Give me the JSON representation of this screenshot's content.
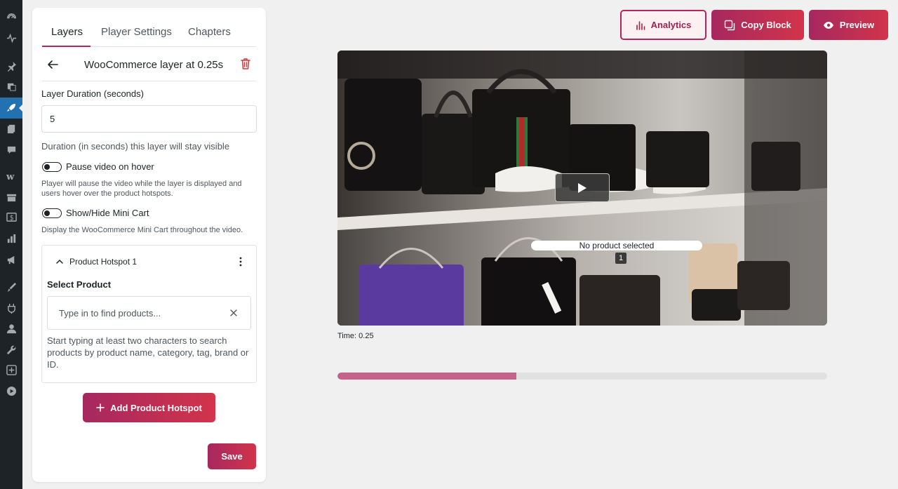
{
  "wp_sidebar": {
    "icons": [
      "dashboard-icon",
      "activity-icon",
      "pin-icon",
      "media-icon",
      "rocket-icon",
      "pages-icon",
      "comments-icon",
      "woocommerce-icon",
      "products-icon",
      "payments-icon",
      "analytics-icon",
      "marketing-icon",
      "appearance-icon",
      "plugins-icon",
      "users-icon",
      "tools-icon",
      "settings-icon",
      "video-player-icon"
    ],
    "active_index": 4
  },
  "panel": {
    "tabs": [
      {
        "label": "Layers",
        "active": true
      },
      {
        "label": "Player Settings",
        "active": false
      },
      {
        "label": "Chapters",
        "active": false
      }
    ],
    "layer_title": "WooCommerce layer at 0.25s",
    "duration": {
      "label": "Layer Duration (seconds)",
      "value": "5",
      "help": "Duration (in seconds) this layer will stay visible"
    },
    "pause_on_hover": {
      "label": "Pause video on hover",
      "help_line1": "Player will pause the video while the layer is displayed and",
      "help_line2": "users hover over the product hotspots.",
      "enabled": false
    },
    "mini_cart": {
      "label": "Show/Hide Mini Cart",
      "help": "Display the WooCommerce Mini Cart throughout the video.",
      "enabled": false
    },
    "hotspot": {
      "title": "Product Hotspot 1",
      "select_label": "Select Product",
      "search_placeholder": "Type in to find products...",
      "help": "Start typing at least two characters to search products by product name, category, tag, brand or ID."
    },
    "add_hotspot_label": "Add Product Hotspot",
    "save_label": "Save"
  },
  "toolbar": {
    "analytics_label": "Analytics",
    "copy_label": "Copy Block",
    "preview_label": "Preview"
  },
  "video": {
    "hotspot_text": "No product selected",
    "hotspot_number": "1",
    "time_prefix": "Time: ",
    "time_value": "0.25",
    "progress_fraction": 0.365
  },
  "colors": {
    "accent": "#b8245a",
    "wp_active": "#2271b1",
    "progress": "#c5628a"
  }
}
